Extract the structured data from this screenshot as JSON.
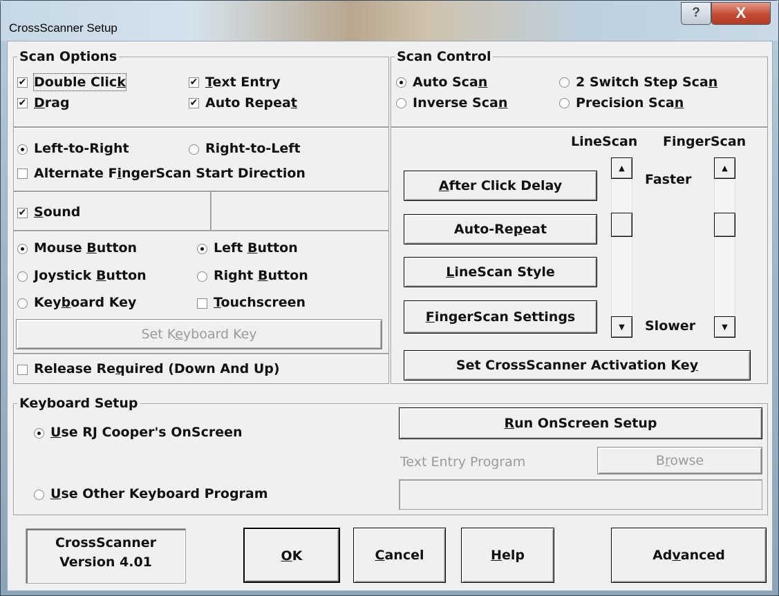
{
  "window": {
    "title": "CrossScanner Setup",
    "help_glyph": "?",
    "close_glyph": "X"
  },
  "scan_options": {
    "title": "Scan Options",
    "double_click": {
      "label": "Double Click",
      "checked": true
    },
    "text_entry": {
      "label": "Text Entry",
      "checked": true
    },
    "drag": {
      "label": "Drag",
      "checked": true
    },
    "auto_repeat": {
      "label": "Auto Repeat",
      "checked": true
    },
    "left_to_right": {
      "label": "Left-to-Right",
      "selected": true
    },
    "right_to_left": {
      "label": "Right-to-Left",
      "selected": false
    },
    "alternate": {
      "label": "Alternate FingerScan Start Direction",
      "checked": false
    },
    "sound": {
      "label": "Sound",
      "checked": true
    },
    "mouse_button": {
      "label": "Mouse Button",
      "selected": true
    },
    "joystick_button": {
      "label": "Joystick Button",
      "selected": false
    },
    "keyboard_key": {
      "label": "Keyboard Key",
      "selected": false
    },
    "left_button": {
      "label": "Left Button",
      "selected": true
    },
    "right_button": {
      "label": "Right Button",
      "selected": false
    },
    "touchscreen": {
      "label": "Touchscreen",
      "checked": false
    },
    "set_keyboard_key": "Set Keyboard Key",
    "release_required": {
      "label": "Release Required (Down And Up)",
      "checked": false
    }
  },
  "scan_control": {
    "title": "Scan Control",
    "auto_scan": {
      "label": "Auto Scan",
      "selected": true
    },
    "two_switch": {
      "label": "2 Switch Step Scan",
      "selected": false
    },
    "inverse_scan": {
      "label": "Inverse Scan",
      "selected": false
    },
    "precision_scan": {
      "label": "Precision Scan",
      "selected": false
    },
    "linescan_header": "LineScan",
    "fingerscan_header": "FingerScan",
    "faster": "Faster",
    "slower": "Slower",
    "after_click_delay": "After Click Delay",
    "auto_repeat_btn": "Auto-Repeat",
    "linescan_style": "LineScan Style",
    "fingerscan_settings": "FingerScan Settings",
    "activation_key": "Set CrossScanner Activation Key",
    "linescan_slider_fraction": 0.3,
    "fingerscan_slider_fraction": 0.3
  },
  "keyboard_setup": {
    "title": "Keyboard Setup",
    "use_rj": {
      "label": "Use RJ Cooper's OnScreen",
      "selected": true
    },
    "use_other": {
      "label": "Use Other Keyboard Program",
      "selected": false
    },
    "run_setup": "Run OnScreen Setup",
    "text_entry_program": "Text Entry Program",
    "browse": "Browse",
    "program_path": ""
  },
  "footer": {
    "version_line1": "CrossScanner",
    "version_line2": "Version 4.01",
    "ok": "OK",
    "cancel": "Cancel",
    "help": "Help",
    "advanced": "Advanced"
  }
}
